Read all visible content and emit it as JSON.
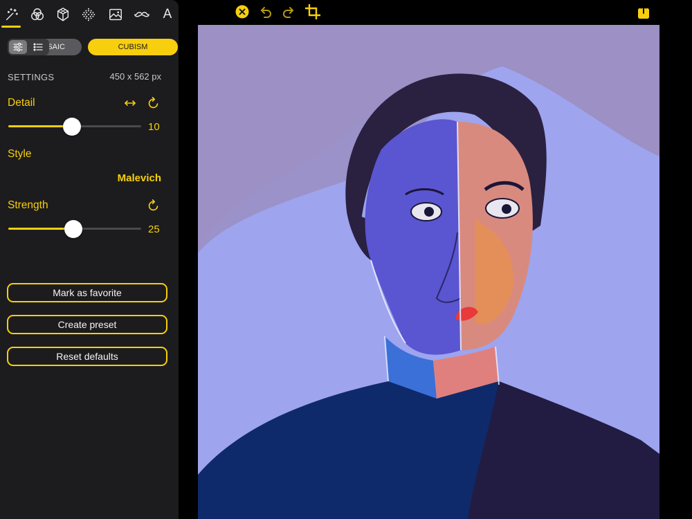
{
  "tool_tabs": [
    {
      "name": "magic-wand-icon",
      "active": true
    },
    {
      "name": "color-circles-icon",
      "active": false
    },
    {
      "name": "cube-icon",
      "active": false
    },
    {
      "name": "dots-pattern-icon",
      "active": false
    },
    {
      "name": "image-icon",
      "active": false
    },
    {
      "name": "mustache-icon",
      "active": false
    },
    {
      "name": "text-icon",
      "label": "A",
      "active": false
    }
  ],
  "segment": {
    "mosaic_label": "MOSAIC",
    "mosaic_visible_label": "SAIC",
    "cubism_label": "CUBISM",
    "selected": "CUBISM"
  },
  "settings": {
    "title": "SETTINGS",
    "size": "450 x 562 px"
  },
  "detail": {
    "label": "Detail",
    "value": "10",
    "fraction": 0.48
  },
  "style": {
    "label": "Style",
    "value": "Malevich"
  },
  "strength": {
    "label": "Strength",
    "value": "25",
    "fraction": 0.49
  },
  "actions": {
    "favorite": "Mark as favorite",
    "preset": "Create preset",
    "reset": "Reset defaults"
  },
  "colors": {
    "accent": "#f8cf0e",
    "panel_bg": "#1c1c1e",
    "canvas_bg": "#9090c8"
  },
  "toolbar_icons": [
    "close-icon",
    "undo-icon",
    "redo-icon",
    "crop-icon",
    "share-icon"
  ]
}
